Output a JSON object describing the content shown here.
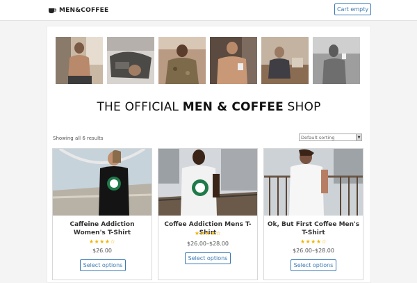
{
  "header": {
    "logo_text": "MEN&COFFEE",
    "logo_icon": "coffee-cup-icon",
    "cart_label": "Cart empty"
  },
  "gallery": {
    "photos": [
      {
        "name": "shirtless man by window"
      },
      {
        "name": "man lying with jacket"
      },
      {
        "name": "man in camo jacket"
      },
      {
        "name": "shirtless man with coffee"
      },
      {
        "name": "man at desk"
      },
      {
        "name": "man drinking coffee"
      }
    ]
  },
  "headline": {
    "prefix": "THE OFFICIAL ",
    "brand": "MEN & COFFEE",
    "suffix": " SHOP"
  },
  "shop": {
    "result_count": "Showing all 6 results",
    "sort_selected": "Default sorting"
  },
  "products": [
    {
      "title": "Caffeine Addiction Women's T-Shirt",
      "stars": "★★★★☆",
      "rating": 4,
      "price": "$26.00",
      "button": "Select options"
    },
    {
      "title": "Coffee Addiction Mens T-Shirt",
      "stars": "★★★★☆",
      "rating": 4,
      "price": "$26.00–$28.00",
      "button": "Select options"
    },
    {
      "title": "Ok, But First Coffee Men's T-Shirt",
      "stars": "★★★★☆",
      "rating": 4,
      "price": "$26.00–$28.00",
      "button": "Select options"
    }
  ],
  "colors": {
    "accent": "#3a7ab5",
    "star": "#f0b400"
  }
}
